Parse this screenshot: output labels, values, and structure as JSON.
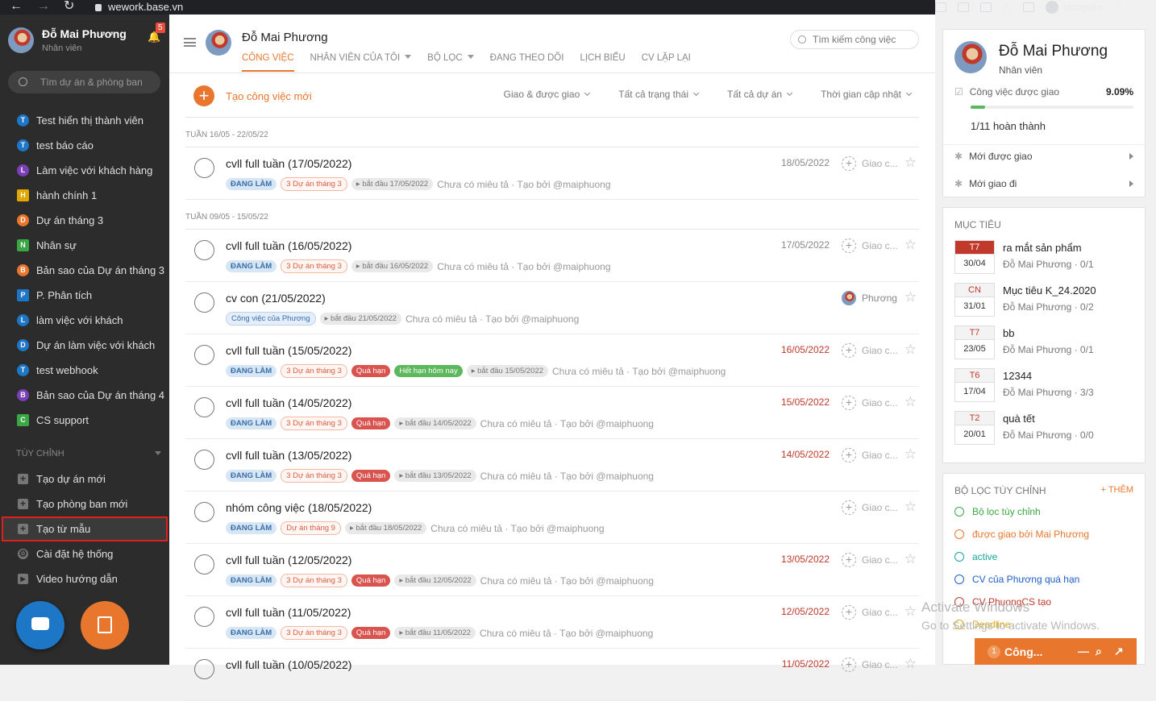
{
  "browser": {
    "url": "wework.base.vn",
    "profile": "Incognito"
  },
  "sidebar": {
    "user_name": "Đỗ Mai Phương",
    "user_role": "Nhân viên",
    "notif_count": "5",
    "search_placeholder": "Tìm dự án & phòng ban",
    "projects": [
      {
        "letter": "T",
        "color": "#1e76c7",
        "label": "Test hiển thị thành viên"
      },
      {
        "letter": "T",
        "color": "#1e76c7",
        "label": "test báo cáo"
      },
      {
        "letter": "L",
        "color": "#7b3fb6",
        "label": "Làm việc với khách hàng"
      },
      {
        "letter": "H",
        "color": "#e0a800",
        "label": "hành chính 1",
        "square": true
      },
      {
        "letter": "D",
        "color": "#e8762d",
        "label": "Dự án tháng 3"
      },
      {
        "letter": "N",
        "color": "#3aa745",
        "label": "Nhân sự",
        "square": true
      },
      {
        "letter": "B",
        "color": "#e8762d",
        "label": "Bản sao của Dự án tháng 3"
      },
      {
        "letter": "P",
        "color": "#1e76c7",
        "label": "P. Phân tích",
        "square": true
      },
      {
        "letter": "L",
        "color": "#1e76c7",
        "label": "làm việc với khách"
      },
      {
        "letter": "D",
        "color": "#1e76c7",
        "label": "Dự án làm việc với khách"
      },
      {
        "letter": "T",
        "color": "#1e76c7",
        "label": "test webhook"
      },
      {
        "letter": "B",
        "color": "#7b3fb6",
        "label": "Bản sao của Dự án tháng 4"
      },
      {
        "letter": "C",
        "color": "#3aa745",
        "label": "CS support",
        "square": true
      }
    ],
    "section_label": "TÙY CHỈNH",
    "tools": [
      "Tạo dự án mới",
      "Tạo phòng ban mới",
      "Tạo từ mẫu",
      "Cài đặt hệ thống",
      "Video hướng dẫn"
    ]
  },
  "header": {
    "name": "Đỗ Mai Phương",
    "tabs": [
      "CÔNG VIỆC",
      "NHÂN VIÊN CỦA TÔI",
      "BỘ LỌC",
      "ĐANG THEO DÕI",
      "LỊCH BIỂU",
      "CV LẶP LẠI"
    ],
    "search_placeholder": "Tìm kiếm công việc"
  },
  "toolbar": {
    "new_task": "Tạo công việc mới",
    "filters": [
      "Giao & được giao",
      "Tất cả trạng thái",
      "Tất cả dự án",
      "Thời gian cập nhật"
    ]
  },
  "weeks": [
    "TUẦN 16/05 - 22/05/22",
    "TUẦN 09/05 - 15/05/22"
  ],
  "tasks": [
    {
      "title": "cvll full tuần (17/05/2022)",
      "status": "ĐANG LÀM",
      "project": "3 Dự án tháng 3",
      "start": "bắt đầu 17/05/2022",
      "desc": "Chưa có miêu tả · Tạo bởi @maiphuong",
      "due": "18/05/2022",
      "assignee": "Giao c..."
    },
    {
      "title": "cvll full tuần (16/05/2022)",
      "status": "ĐANG LÀM",
      "project": "3 Dự án tháng 3",
      "start": "bắt đầu 16/05/2022",
      "desc": "Chưa có miêu tả · Tạo bởi @maiphuong",
      "due": "17/05/2022",
      "assignee": "Giao c..."
    },
    {
      "title": "cv con (21/05/2022)",
      "status": "Công việc của Phương",
      "start": "bắt đầu 21/05/2022",
      "desc": "Chưa có miêu tả · Tạo bởi @maiphuong",
      "due": "",
      "assignee": "Phương"
    },
    {
      "title": "cvll full tuần (15/05/2022)",
      "status": "ĐANG LÀM",
      "project": "3 Dự án tháng 3",
      "late": "Quá hạn",
      "today": "Hết hạn hôm nay",
      "start": "bắt đầu 15/05/2022",
      "desc": "Chưa có miêu tả · Tạo bởi @maiphuong",
      "due": "16/05/2022",
      "assignee": "Giao c..."
    },
    {
      "title": "cvll full tuần (14/05/2022)",
      "status": "ĐANG LÀM",
      "project": "3 Dự án tháng 3",
      "late": "Quá hạn",
      "start": "bắt đầu 14/05/2022",
      "desc": "Chưa có miêu tả · Tạo bởi @maiphuong",
      "due": "15/05/2022",
      "assignee": "Giao c..."
    },
    {
      "title": "cvll full tuần (13/05/2022)",
      "status": "ĐANG LÀM",
      "project": "3 Dự án tháng 3",
      "late": "Quá hạn",
      "start": "bắt đầu 13/05/2022",
      "desc": "Chưa có miêu tả · Tạo bởi @maiphuong",
      "due": "14/05/2022",
      "assignee": "Giao c..."
    },
    {
      "title": "nhóm công việc (18/05/2022)",
      "status": "ĐANG LÀM",
      "project": "Dự án tháng 9",
      "start": "bắt đầu 18/05/2022",
      "desc": "Chưa có miêu tả · Tạo bởi @maiphuong",
      "due": "",
      "assignee": "Giao c..."
    },
    {
      "title": "cvll full tuần (12/05/2022)",
      "status": "ĐANG LÀM",
      "project": "3 Dự án tháng 3",
      "late": "Quá hạn",
      "start": "bắt đầu 12/05/2022",
      "desc": "Chưa có miêu tả · Tạo bởi @maiphuong",
      "due": "13/05/2022",
      "assignee": "Giao c..."
    },
    {
      "title": "cvll full tuần (11/05/2022)",
      "status": "ĐANG LÀM",
      "project": "3 Dự án tháng 3",
      "late": "Quá hạn",
      "start": "bắt đầu 11/05/2022",
      "desc": "Chưa có miêu tả · Tạo bởi @maiphuong",
      "due": "12/05/2022",
      "assignee": "Giao c..."
    },
    {
      "title": "cvll full tuần (10/05/2022)",
      "status": "",
      "start": "",
      "desc": "",
      "due": "11/05/2022",
      "assignee": "Giao c..."
    }
  ],
  "right": {
    "name": "Đỗ Mai Phương",
    "role": "Nhân viên",
    "assigned_label": "Công việc được giao",
    "assigned_pct": "9.09%",
    "progress": 0.0909,
    "done_text": "1/11 hoàn thành",
    "new_assigned": "Mới được giao",
    "new_sent": "Mới giao đi",
    "goals_title": "MỤC TIÊU",
    "goals": [
      {
        "dow": "T7",
        "date": "30/04",
        "title": "ra mắt sản phẩm",
        "sub": "Đỗ Mai Phương  ·  0/1",
        "active": true
      },
      {
        "dow": "CN",
        "date": "31/01",
        "title": "Mục tiêu K_24.2020",
        "sub": "Đỗ Mai Phương  ·  0/2"
      },
      {
        "dow": "T7",
        "date": "23/05",
        "title": "bb",
        "sub": "Đỗ Mai Phương  ·  0/1"
      },
      {
        "dow": "T6",
        "date": "17/04",
        "title": "12344",
        "sub": "Đỗ Mai Phương  ·  3/3"
      },
      {
        "dow": "T2",
        "date": "20/01",
        "title": "quà tết",
        "sub": "Đỗ Mai Phương  ·  0/0"
      }
    ],
    "filters_title": "BỘ LỌC TÙY CHỈNH",
    "filters_add": "+ THÊM",
    "custom_filters": [
      {
        "label": "Bộ lọc tùy chỉnh",
        "color": "#3aa745"
      },
      {
        "label": "được giao bởi Mai Phương",
        "color": "#e8762d"
      },
      {
        "label": "active",
        "color": "#1aa39a"
      },
      {
        "label": "CV của Phương quá hạn",
        "color": "#1e5fc7"
      },
      {
        "label": "CV PhuongCS tạo",
        "color": "#c0392b"
      },
      {
        "label": "Deadline",
        "color": "#e0a800"
      }
    ]
  },
  "watermark": {
    "line1": "Activate Windows",
    "line2": "Go to Settings to activate Windows."
  },
  "mini_panel": {
    "count": "1",
    "label": "Công..."
  }
}
